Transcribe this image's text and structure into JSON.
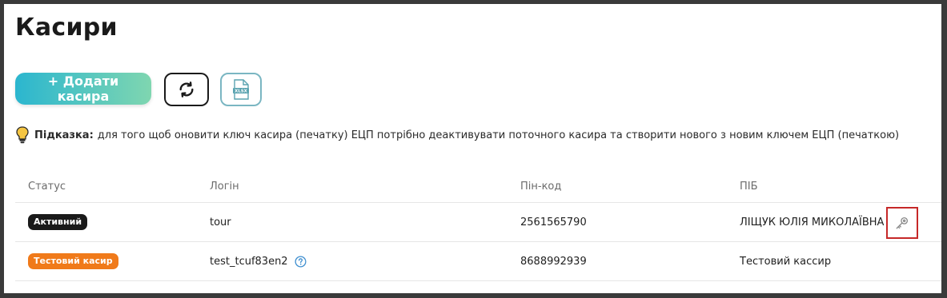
{
  "page": {
    "title": "Касири"
  },
  "toolbar": {
    "add_label": "+ Додати касира",
    "refresh_icon": "refresh-icon",
    "export_icon": "xlsx-file-icon",
    "export_badge": "XLSX"
  },
  "hint": {
    "icon": "lightbulb-icon",
    "prefix": "Підказка:",
    "text": "для того щоб оновити ключ касира (печатку) ЕЦП потрібно деактивувати поточного касира та створити нового з новим ключем ЕЦП (печаткою)"
  },
  "table": {
    "columns": [
      "Статус",
      "Логін",
      "Пін-код",
      "ПІБ"
    ],
    "rows": [
      {
        "status": "Активний",
        "status_color": "#1a1a1a",
        "login": "tour",
        "pin": "2561565790",
        "name": "ЛІЩУК ЮЛІЯ МИКОЛАЇВНА",
        "action_icon": "key-icon"
      },
      {
        "status": "Тестовий касир",
        "status_color": "#f07a1a",
        "login": "test_tcuf83en2",
        "login_icon": "question-icon",
        "pin": "8688992939",
        "name": "Тестовий кассир"
      }
    ]
  },
  "colors": {
    "accent_gradient_start": "#2bb6cf",
    "accent_gradient_end": "#7fd6b0",
    "highlight": "#c62828"
  }
}
